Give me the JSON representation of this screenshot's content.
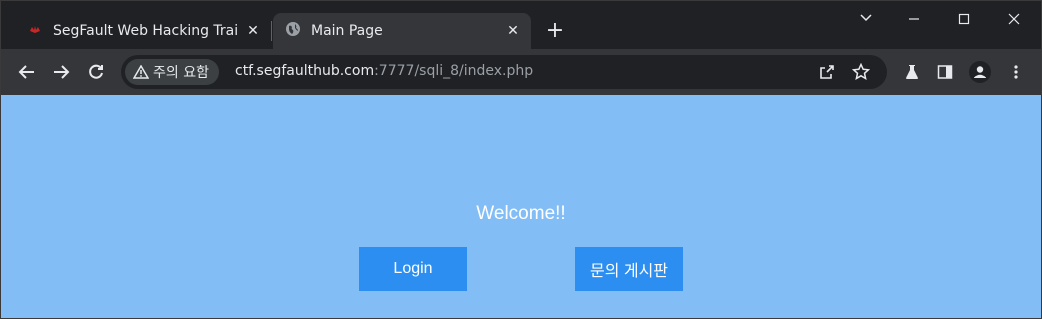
{
  "tabs": {
    "inactive": {
      "title": "SegFault Web Hacking Trai",
      "close": "✕"
    },
    "active": {
      "title": "Main Page",
      "close": "✕"
    },
    "new_tab": "+"
  },
  "window": {
    "dropdown": "⌄",
    "minimize": "—",
    "maximize": "☐",
    "close": "✕"
  },
  "toolbar": {
    "security_label": "주의 요함",
    "url_host": "ctf.segfaulthub.com",
    "url_rest": ":7777/sqli_8/index.php"
  },
  "page": {
    "welcome": "Welcome!!",
    "login_button": "Login",
    "board_button": "문의 게시판",
    "background_color": "#82bdf6",
    "button_color": "#2b8ef0"
  },
  "icons": {
    "favicon": "segfault-icon",
    "globe": "globe-icon"
  }
}
